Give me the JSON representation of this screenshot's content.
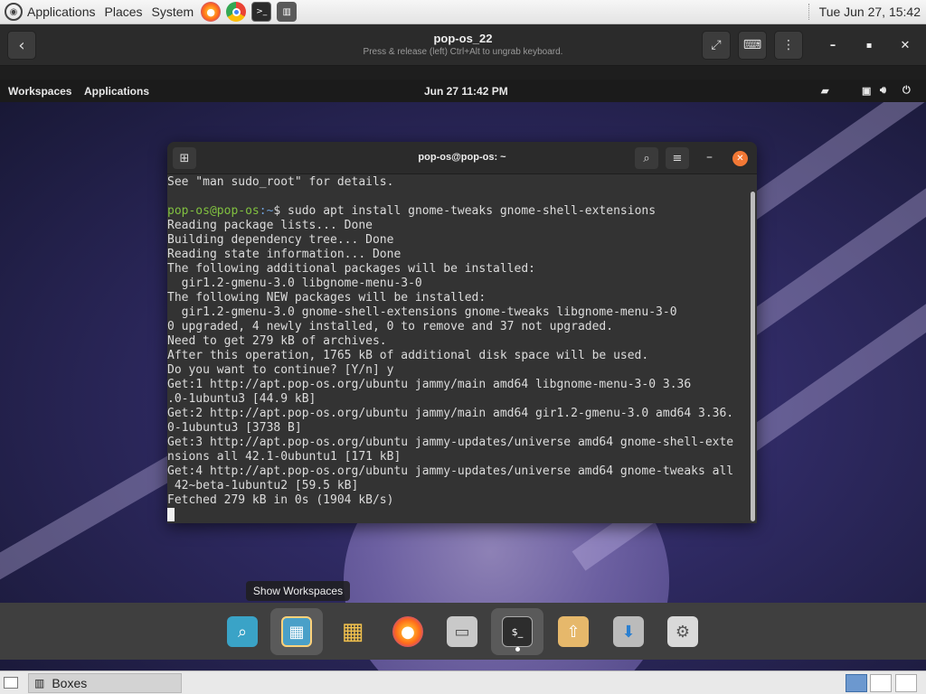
{
  "host_panel": {
    "menus": [
      "Applications",
      "Places",
      "System"
    ],
    "clock": "Tue Jun 27, 15:42"
  },
  "boxes_header": {
    "title": "pop-os_22",
    "subtitle": "Press & release (left) Ctrl+Alt to ungrab keyboard."
  },
  "guest_topbar": {
    "workspaces": "Workspaces",
    "applications": "Applications",
    "clock": "Jun 27  11:42 PM"
  },
  "terminal": {
    "title": "pop-os@pop-os: ~",
    "lines": [
      "See \"man sudo_root\" for details.",
      "",
      "__PROMPT__",
      "Reading package lists... Done",
      "Building dependency tree... Done",
      "Reading state information... Done",
      "The following additional packages will be installed:",
      "  gir1.2-gmenu-3.0 libgnome-menu-3-0",
      "The following NEW packages will be installed:",
      "  gir1.2-gmenu-3.0 gnome-shell-extensions gnome-tweaks libgnome-menu-3-0",
      "0 upgraded, 4 newly installed, 0 to remove and 37 not upgraded.",
      "Need to get 279 kB of archives.",
      "After this operation, 1765 kB of additional disk space will be used.",
      "Do you want to continue? [Y/n] y",
      "Get:1 http://apt.pop-os.org/ubuntu jammy/main amd64 libgnome-menu-3-0 3.36",
      ".0-1ubuntu3 [44.9 kB]",
      "Get:2 http://apt.pop-os.org/ubuntu jammy/main amd64 gir1.2-gmenu-3.0 amd64 3.36.",
      "0-1ubuntu3 [3738 B]",
      "Get:3 http://apt.pop-os.org/ubuntu jammy-updates/universe amd64 gnome-shell-exte",
      "nsions all 42.1-0ubuntu1 [171 kB]",
      "Get:4 http://apt.pop-os.org/ubuntu jammy-updates/universe amd64 gnome-tweaks all",
      " 42~beta-1ubuntu2 [59.5 kB]",
      "Fetched 279 kB in 0s (1904 kB/s)"
    ],
    "prompt_user": "pop-os@pop-os",
    "prompt_sep": ":~$ ",
    "prompt_cmd": "sudo apt install gnome-tweaks gnome-shell-extensions"
  },
  "dock": {
    "tooltip": "Show Workspaces",
    "items": [
      "search",
      "workspaces",
      "app-grid",
      "firefox",
      "files",
      "terminal",
      "launcher",
      "installer",
      "settings"
    ]
  },
  "host_bottom": {
    "task_label": "Boxes"
  }
}
